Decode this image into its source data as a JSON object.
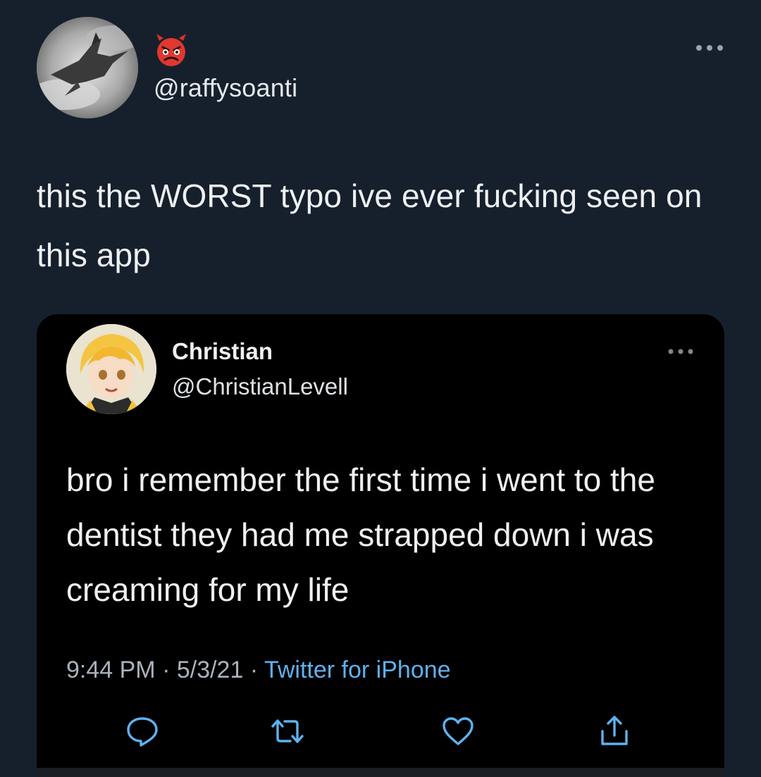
{
  "outer_tweet": {
    "handle": "@raffysoanti",
    "badge_icon": "angry-devil-emoji",
    "text": "this the WORST typo ive ever fucking seen on this app",
    "more_icon": "more-dots-icon"
  },
  "quoted_tweet": {
    "name": "Christian",
    "handle": "@ChristianLevell",
    "text": "bro i remember the first time i went to the dentist they had me strapped down i was creaming for my life",
    "time": "9:44 PM",
    "separator": " · ",
    "date": "5/3/21",
    "source": "Twitter for iPhone",
    "actions": [
      "reply-icon",
      "retweet-icon",
      "like-icon",
      "share-icon"
    ]
  },
  "colors": {
    "background": "#16202c",
    "card": "#000000",
    "link": "#5fb1ee",
    "icon": "#5fb1ee"
  }
}
